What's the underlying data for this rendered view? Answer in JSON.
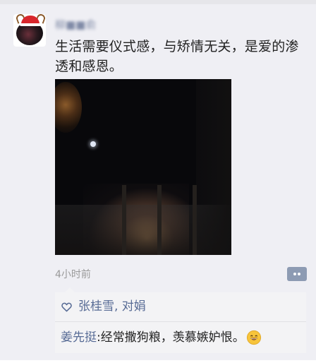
{
  "post": {
    "author_name": "柳■■俞",
    "text": "生活需要仪式感，与矫情无关，是爱的渗透和感恩。",
    "time": "4小时前"
  },
  "likes": {
    "names": "张桂雪, 对娟"
  },
  "comments": [
    {
      "author": "姜先挺",
      "separator": ": ",
      "text": "经常撒狗粮，羡慕嫉妒恨。"
    }
  ],
  "icons": {
    "like": "heart-outline-icon",
    "comment": "comment-dots-icon",
    "emoji": "grinning-emoji-icon"
  },
  "colors": {
    "link": "#576b95",
    "text": "#222222",
    "meta": "#9a9a9a",
    "panel": "#f3f3f5",
    "background": "#efeff4"
  }
}
